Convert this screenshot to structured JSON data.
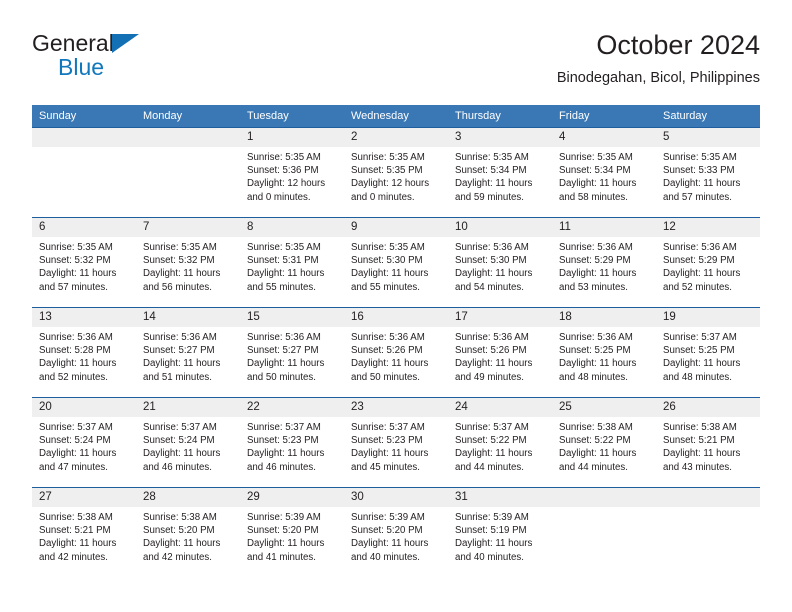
{
  "brand": {
    "name_part1": "General",
    "name_part2": "Blue",
    "triangle_icon": "triangle-icon",
    "accent_color": "#1278be"
  },
  "header": {
    "title": "October 2024",
    "location": "Binodegahan, Bicol, Philippines"
  },
  "theme": {
    "header_blue": "#3a78b5",
    "rule_blue": "#1f5e9e",
    "daynum_band": "#efefef",
    "text": "#231f20"
  },
  "weekdays": [
    "Sunday",
    "Monday",
    "Tuesday",
    "Wednesday",
    "Thursday",
    "Friday",
    "Saturday"
  ],
  "weeks": [
    [
      {
        "day": ""
      },
      {
        "day": ""
      },
      {
        "day": "1",
        "sunrise": "Sunrise: 5:35 AM",
        "sunset": "Sunset: 5:36 PM",
        "daylight": "Daylight: 12 hours and 0 minutes."
      },
      {
        "day": "2",
        "sunrise": "Sunrise: 5:35 AM",
        "sunset": "Sunset: 5:35 PM",
        "daylight": "Daylight: 12 hours and 0 minutes."
      },
      {
        "day": "3",
        "sunrise": "Sunrise: 5:35 AM",
        "sunset": "Sunset: 5:34 PM",
        "daylight": "Daylight: 11 hours and 59 minutes."
      },
      {
        "day": "4",
        "sunrise": "Sunrise: 5:35 AM",
        "sunset": "Sunset: 5:34 PM",
        "daylight": "Daylight: 11 hours and 58 minutes."
      },
      {
        "day": "5",
        "sunrise": "Sunrise: 5:35 AM",
        "sunset": "Sunset: 5:33 PM",
        "daylight": "Daylight: 11 hours and 57 minutes."
      }
    ],
    [
      {
        "day": "6",
        "sunrise": "Sunrise: 5:35 AM",
        "sunset": "Sunset: 5:32 PM",
        "daylight": "Daylight: 11 hours and 57 minutes."
      },
      {
        "day": "7",
        "sunrise": "Sunrise: 5:35 AM",
        "sunset": "Sunset: 5:32 PM",
        "daylight": "Daylight: 11 hours and 56 minutes."
      },
      {
        "day": "8",
        "sunrise": "Sunrise: 5:35 AM",
        "sunset": "Sunset: 5:31 PM",
        "daylight": "Daylight: 11 hours and 55 minutes."
      },
      {
        "day": "9",
        "sunrise": "Sunrise: 5:35 AM",
        "sunset": "Sunset: 5:30 PM",
        "daylight": "Daylight: 11 hours and 55 minutes."
      },
      {
        "day": "10",
        "sunrise": "Sunrise: 5:36 AM",
        "sunset": "Sunset: 5:30 PM",
        "daylight": "Daylight: 11 hours and 54 minutes."
      },
      {
        "day": "11",
        "sunrise": "Sunrise: 5:36 AM",
        "sunset": "Sunset: 5:29 PM",
        "daylight": "Daylight: 11 hours and 53 minutes."
      },
      {
        "day": "12",
        "sunrise": "Sunrise: 5:36 AM",
        "sunset": "Sunset: 5:29 PM",
        "daylight": "Daylight: 11 hours and 52 minutes."
      }
    ],
    [
      {
        "day": "13",
        "sunrise": "Sunrise: 5:36 AM",
        "sunset": "Sunset: 5:28 PM",
        "daylight": "Daylight: 11 hours and 52 minutes."
      },
      {
        "day": "14",
        "sunrise": "Sunrise: 5:36 AM",
        "sunset": "Sunset: 5:27 PM",
        "daylight": "Daylight: 11 hours and 51 minutes."
      },
      {
        "day": "15",
        "sunrise": "Sunrise: 5:36 AM",
        "sunset": "Sunset: 5:27 PM",
        "daylight": "Daylight: 11 hours and 50 minutes."
      },
      {
        "day": "16",
        "sunrise": "Sunrise: 5:36 AM",
        "sunset": "Sunset: 5:26 PM",
        "daylight": "Daylight: 11 hours and 50 minutes."
      },
      {
        "day": "17",
        "sunrise": "Sunrise: 5:36 AM",
        "sunset": "Sunset: 5:26 PM",
        "daylight": "Daylight: 11 hours and 49 minutes."
      },
      {
        "day": "18",
        "sunrise": "Sunrise: 5:36 AM",
        "sunset": "Sunset: 5:25 PM",
        "daylight": "Daylight: 11 hours and 48 minutes."
      },
      {
        "day": "19",
        "sunrise": "Sunrise: 5:37 AM",
        "sunset": "Sunset: 5:25 PM",
        "daylight": "Daylight: 11 hours and 48 minutes."
      }
    ],
    [
      {
        "day": "20",
        "sunrise": "Sunrise: 5:37 AM",
        "sunset": "Sunset: 5:24 PM",
        "daylight": "Daylight: 11 hours and 47 minutes."
      },
      {
        "day": "21",
        "sunrise": "Sunrise: 5:37 AM",
        "sunset": "Sunset: 5:24 PM",
        "daylight": "Daylight: 11 hours and 46 minutes."
      },
      {
        "day": "22",
        "sunrise": "Sunrise: 5:37 AM",
        "sunset": "Sunset: 5:23 PM",
        "daylight": "Daylight: 11 hours and 46 minutes."
      },
      {
        "day": "23",
        "sunrise": "Sunrise: 5:37 AM",
        "sunset": "Sunset: 5:23 PM",
        "daylight": "Daylight: 11 hours and 45 minutes."
      },
      {
        "day": "24",
        "sunrise": "Sunrise: 5:37 AM",
        "sunset": "Sunset: 5:22 PM",
        "daylight": "Daylight: 11 hours and 44 minutes."
      },
      {
        "day": "25",
        "sunrise": "Sunrise: 5:38 AM",
        "sunset": "Sunset: 5:22 PM",
        "daylight": "Daylight: 11 hours and 44 minutes."
      },
      {
        "day": "26",
        "sunrise": "Sunrise: 5:38 AM",
        "sunset": "Sunset: 5:21 PM",
        "daylight": "Daylight: 11 hours and 43 minutes."
      }
    ],
    [
      {
        "day": "27",
        "sunrise": "Sunrise: 5:38 AM",
        "sunset": "Sunset: 5:21 PM",
        "daylight": "Daylight: 11 hours and 42 minutes."
      },
      {
        "day": "28",
        "sunrise": "Sunrise: 5:38 AM",
        "sunset": "Sunset: 5:20 PM",
        "daylight": "Daylight: 11 hours and 42 minutes."
      },
      {
        "day": "29",
        "sunrise": "Sunrise: 5:39 AM",
        "sunset": "Sunset: 5:20 PM",
        "daylight": "Daylight: 11 hours and 41 minutes."
      },
      {
        "day": "30",
        "sunrise": "Sunrise: 5:39 AM",
        "sunset": "Sunset: 5:20 PM",
        "daylight": "Daylight: 11 hours and 40 minutes."
      },
      {
        "day": "31",
        "sunrise": "Sunrise: 5:39 AM",
        "sunset": "Sunset: 5:19 PM",
        "daylight": "Daylight: 11 hours and 40 minutes."
      },
      {
        "day": ""
      },
      {
        "day": ""
      }
    ]
  ]
}
